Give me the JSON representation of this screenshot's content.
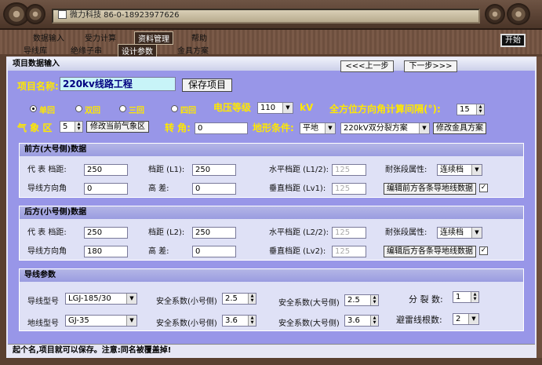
{
  "window": {
    "title": "微力科技 86-0-18923977626"
  },
  "menu": {
    "row1": [
      "数据输入",
      "受力计算",
      "资料管理",
      "帮助"
    ],
    "row2": [
      "导线库",
      "绝缘子串",
      "设计参数",
      "金具方案"
    ],
    "start_label": "开始"
  },
  "panel": {
    "title": "项目数据输入",
    "prev_label": "<<<上一步",
    "next_label": "下一步>>>",
    "project_label": "项目名称:",
    "project_value": "220kv线路工程",
    "save_label": "保存项目"
  },
  "circuit": {
    "options": [
      "单回",
      "双回",
      "三回",
      "四回"
    ],
    "selected": "单回",
    "voltage_label": "电压等级",
    "voltage_value": "110",
    "voltage_unit": "kV",
    "interval_label": "全方位方向角计算间隔(°):",
    "interval_value": "15"
  },
  "weather": {
    "label": "气 象 区",
    "value": "5",
    "edit_label": "修改当前气象区",
    "turn_label": "转 角:",
    "turn_value": "0",
    "terrain_label": "地形条件:",
    "terrain_value": "平地",
    "split_value": "220kV双分裂方案",
    "fitting_label": "修改金具方案"
  },
  "front": {
    "title": "前方(大号侧)数据",
    "rep_span_label": "代 表 档距:",
    "rep_span_value": "250",
    "span_label": "档距 (L1):",
    "span_value": "250",
    "hspan_label": "水平档距 (L1/2):",
    "hspan_value": "125",
    "tension_label": "耐张段属性:",
    "tension_value": "连续档",
    "dir_label": "导线方向角",
    "dir_value": "0",
    "height_label": "高     差:",
    "height_value": "0",
    "vspan_label": "垂直档距 (Lv1):",
    "vspan_value": "125",
    "edit_label": "编辑前方各条导地线数据",
    "checked": "✓"
  },
  "back": {
    "title": "后方(小号侧)数据",
    "rep_span_label": "代 表 档距:",
    "rep_span_value": "250",
    "span_label": "档距 (L2):",
    "span_value": "250",
    "hspan_label": "水平档距 (L2/2):",
    "hspan_value": "125",
    "tension_label": "耐张段属性:",
    "tension_value": "连续档",
    "dir_label": "导线方向角",
    "dir_value": "180",
    "height_label": "高     差:",
    "height_value": "0",
    "vspan_label": "垂直档距 (Lv2):",
    "vspan_value": "125",
    "edit_label": "编辑后方各条导地线数据",
    "checked": "✓"
  },
  "wire": {
    "title": "导线参数",
    "conductor_label": "导线型号",
    "conductor_value": "LGJ-185/30",
    "ground_label": "地线型号",
    "ground_value": "GJ-35",
    "sf_small_label": "安全系数(小号侧)",
    "sf_small_value1": "2.5",
    "sf_small_value2": "3.6",
    "sf_big_label": "安全系数(大号侧)",
    "sf_big_value1": "2.5",
    "sf_big_value2": "3.6",
    "split_label": "分 裂 数:",
    "split_value": "1",
    "lightning_label": "避雷线根数:",
    "lightning_value": "2"
  },
  "footer": {
    "hint": "起个名,项目就可以保存。注意:同名被覆盖掉!"
  }
}
